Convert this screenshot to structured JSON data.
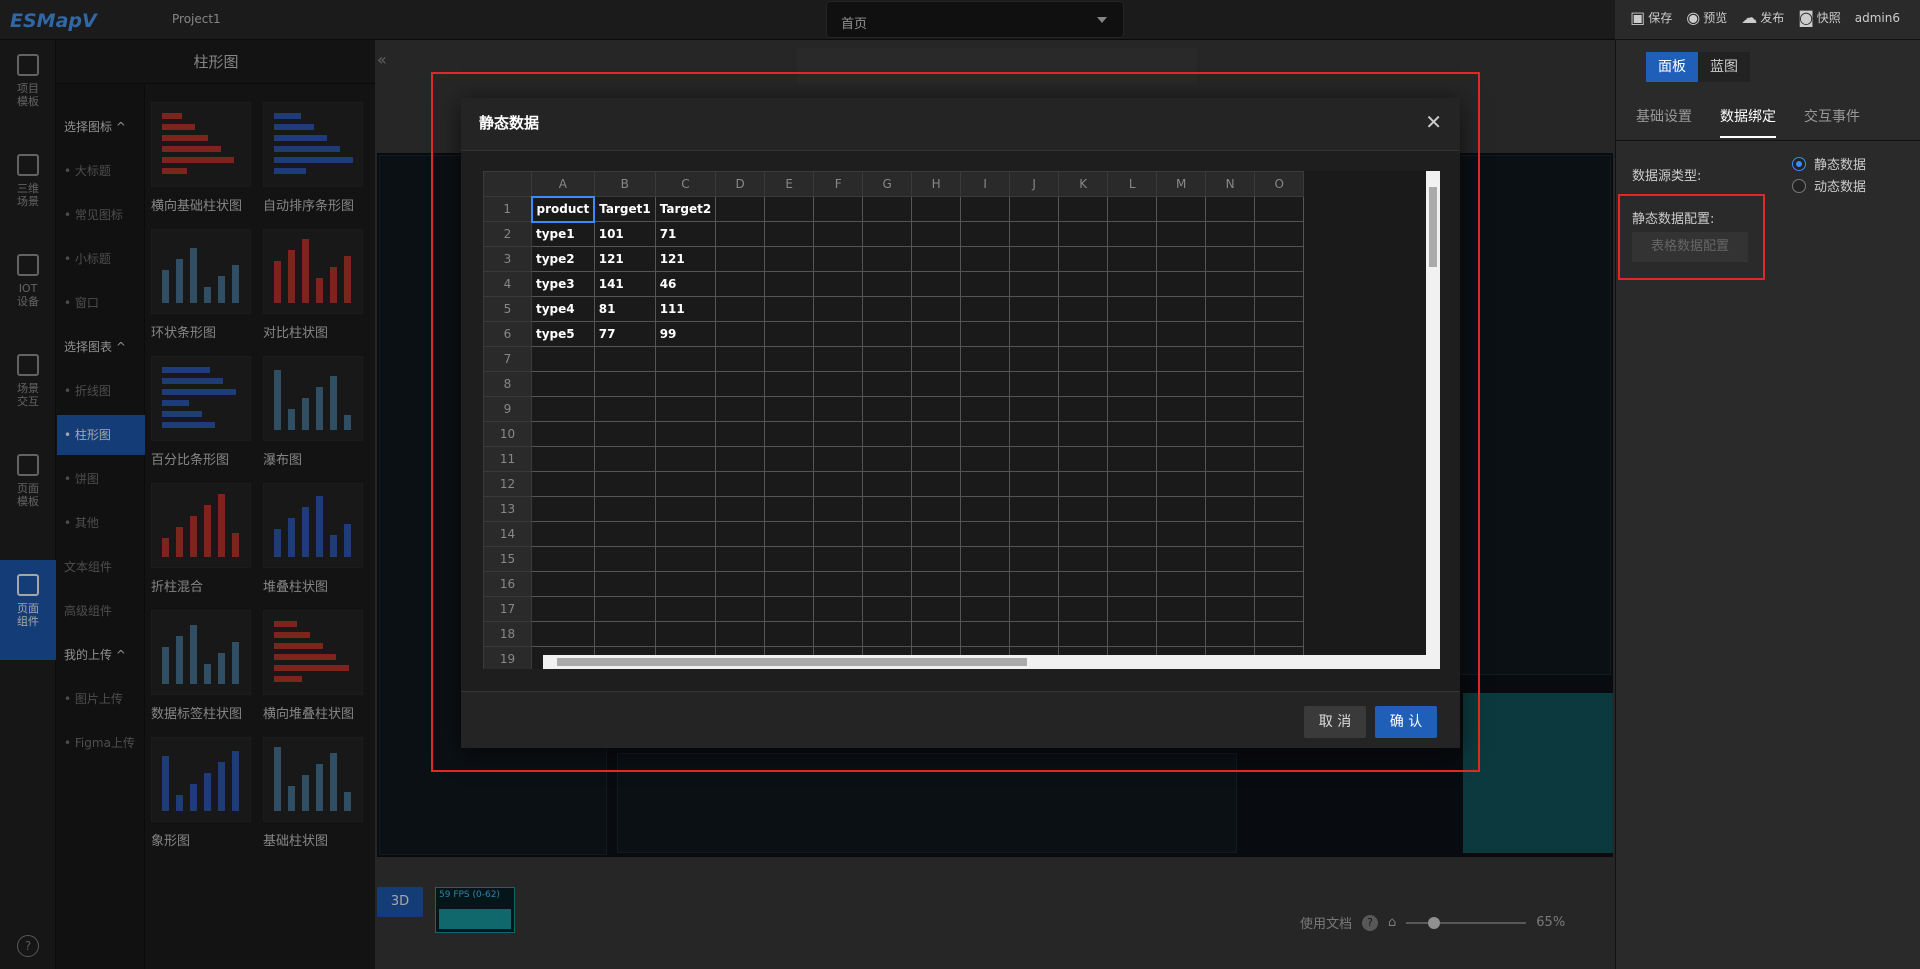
{
  "app": {
    "logo": "ESMapV",
    "project": "Project1"
  },
  "topbar": {
    "page_select": "首页",
    "actions": [
      {
        "icon": "save-icon",
        "label": "保存"
      },
      {
        "icon": "preview-icon",
        "label": "预览"
      },
      {
        "icon": "publish-icon",
        "label": "发布"
      },
      {
        "icon": "snapshot-icon",
        "label": "快照"
      }
    ],
    "user": "admin6"
  },
  "rail": [
    {
      "label": "项目\n模板"
    },
    {
      "label": "三维\n场景"
    },
    {
      "label": "IOT\n设备"
    },
    {
      "label": "场景\n交互"
    },
    {
      "label": "页面\n模板"
    },
    {
      "label": "页面\n组件",
      "active": true
    }
  ],
  "catpanel": {
    "title": "柱形图",
    "categories": [
      {
        "label": "选择图标 ^",
        "head": true
      },
      {
        "label": "• 大标题"
      },
      {
        "label": "• 常见图标"
      },
      {
        "label": "• 小标题"
      },
      {
        "label": "• 窗口"
      },
      {
        "label": "选择图表 ^",
        "head": true
      },
      {
        "label": "• 折线图"
      },
      {
        "label": "• 柱形图",
        "active": true
      },
      {
        "label": "• 饼图"
      },
      {
        "label": "• 其他"
      },
      {
        "label": "文本组件"
      },
      {
        "label": "高级组件"
      },
      {
        "label": "我的上传 ^",
        "head": true
      },
      {
        "label": "• 图片上传"
      },
      {
        "label": "• Figma上传"
      }
    ],
    "thumbs": [
      "横向基础柱状图",
      "自动排序条形图",
      "环状条形图",
      "对比柱状图",
      "百分比条形图",
      "瀑布图",
      "折柱混合",
      "堆叠柱状图",
      "数据标签柱状图",
      "横向堆叠柱状图",
      "象形图",
      "基础柱状图"
    ]
  },
  "canvas": {
    "mode": "3D",
    "fps": "59 FPS (0-62)",
    "doc_label": "使用文档",
    "zoom": "65%",
    "zoom_fraction": 0.2
  },
  "rpanel": {
    "tabs1": [
      {
        "label": "面板",
        "active": true
      },
      {
        "label": "蓝图"
      }
    ],
    "tabs2": [
      {
        "label": "基础设置"
      },
      {
        "label": "数据绑定",
        "active": true
      },
      {
        "label": "交互事件"
      }
    ],
    "source_type_label": "数据源类型:",
    "source_options": [
      {
        "label": "静态数据",
        "checked": true
      },
      {
        "label": "动态数据"
      }
    ],
    "static_config_label": "静态数据配置:",
    "config_button": "表格数据配置"
  },
  "modal": {
    "title": "静态数据",
    "columns": [
      "A",
      "B",
      "C",
      "D",
      "E",
      "F",
      "G",
      "H",
      "I",
      "J",
      "K",
      "L",
      "M",
      "N",
      "O"
    ],
    "rows": [
      [
        "product",
        "Target1",
        "Target2"
      ],
      [
        "type1",
        "101",
        "71"
      ],
      [
        "type2",
        "121",
        "121"
      ],
      [
        "type3",
        "141",
        "46"
      ],
      [
        "type4",
        "81",
        "111"
      ],
      [
        "type5",
        "77",
        "99"
      ]
    ],
    "row_count": 19,
    "cancel": "取 消",
    "ok": "确 认"
  },
  "colors": {
    "accent": "#1f5fb8",
    "highlight": "#e02828",
    "teal": "#1aa0a8"
  }
}
